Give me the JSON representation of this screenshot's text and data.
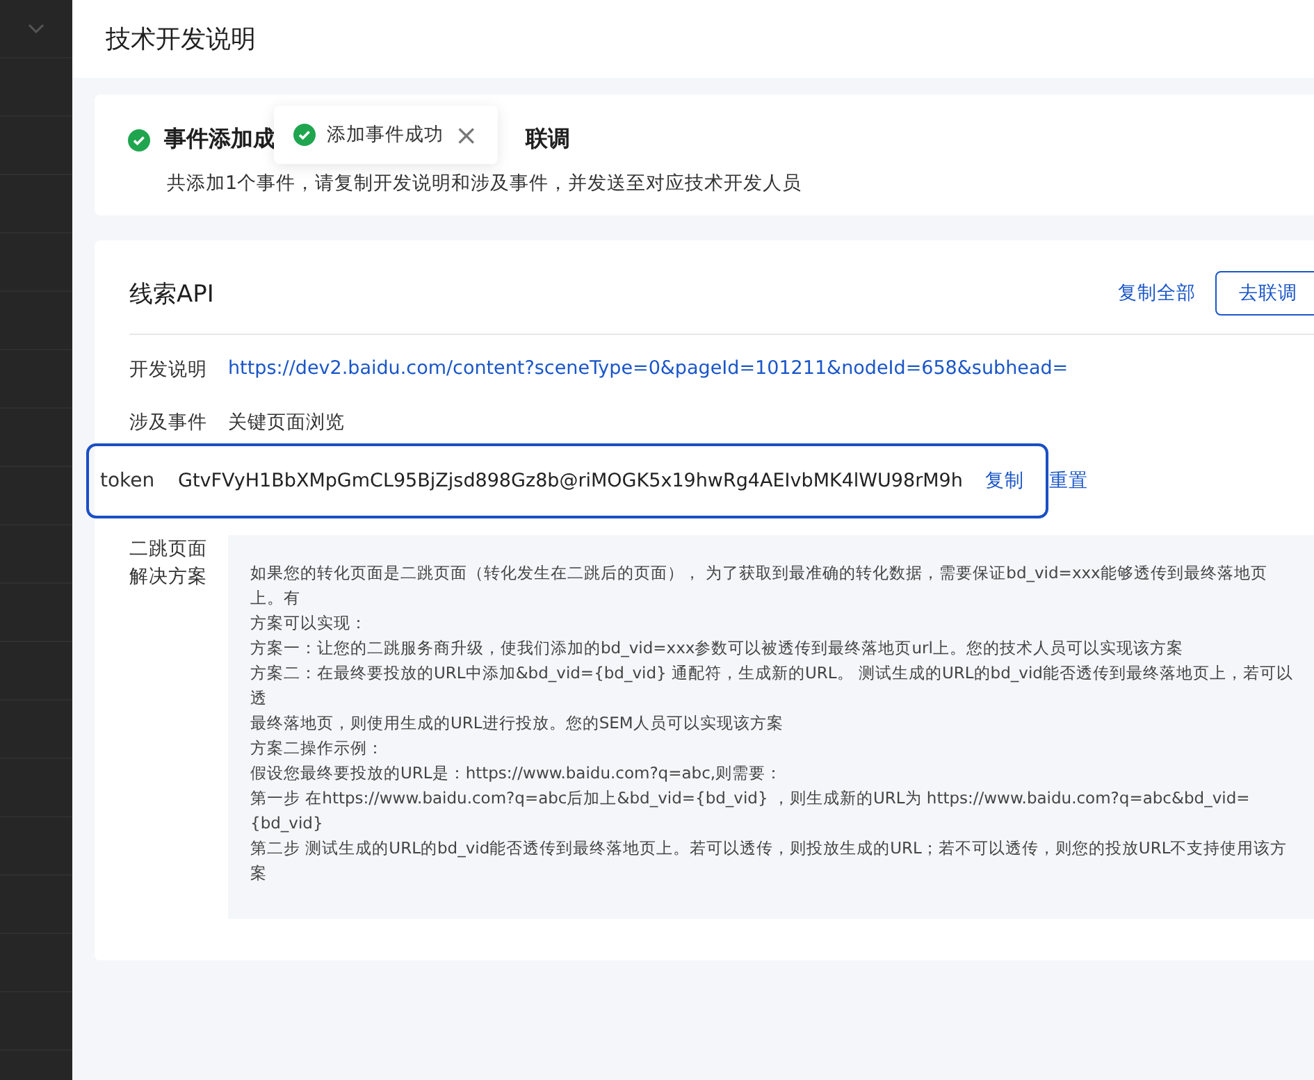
{
  "drawer": {
    "title": "技术开发说明"
  },
  "result": {
    "heading_before": "事件添加成",
    "heading_after": "联调",
    "description": "共添加1个事件，请复制开发说明和涉及事件，并发送至对应技术开发人员"
  },
  "toast": {
    "message": "添加事件成功",
    "close": "×"
  },
  "api_card": {
    "title": "线索API",
    "actions": [
      {
        "label": "复制全部",
        "kind": "link"
      },
      {
        "label": "去联调",
        "kind": "outlined"
      }
    ],
    "fields": [
      {
        "label": "开发说明",
        "value": "https://dev2.baidu.com/content?sceneType=0&pageId=101211&nodeId=658&subhead=",
        "kind": "link"
      },
      {
        "label": "涉及事件",
        "value": "关键页面浏览",
        "kind": "text"
      }
    ],
    "token": {
      "label": "token",
      "value": "GtvFVyH1BbXMpGmCL95BjZjsd898Gz8b@riMOGK5x19hwRg4AEIvbMK4lWU98rM9h",
      "copy": "复制",
      "reset": "重置",
      "highlighted": true
    },
    "solution": {
      "label": "二跳页面解决方案",
      "lines": [
        "如果您的转化页面是二跳页面（转化发生在二跳后的页面）， 为了获取到最准确的转化数据，需要保证bd_vid=xxx能够透传到最终落地页上。有",
        "方案可以实现：",
        "方案一：让您的二跳服务商升级，使我们添加的bd_vid=xxx参数可以被透传到最终落地页url上。您的技术人员可以实现该方案",
        "方案二：在最终要投放的URL中添加&bd_vid={bd_vid} 通配符，生成新的URL。 测试生成的URL的bd_vid能否透传到最终落地页上，若可以透",
        "最终落地页，则使用生成的URL进行投放。您的SEM人员可以实现该方案",
        "方案二操作示例：",
        "假设您最终要投放的URL是：https://www.baidu.com?q=abc,则需要：",
        "第一步 在https://www.baidu.com?q=abc后加上&bd_vid={bd_vid} ，则生成新的URL为 https://www.baidu.com?q=abc&bd_vid={bd_vid}",
        "第二步 测试生成的URL的bd_vid能否透传到最终落地页上。若可以透传，则投放生成的URL；若不可以透传，则您的投放URL不支持使用该方案"
      ]
    }
  }
}
